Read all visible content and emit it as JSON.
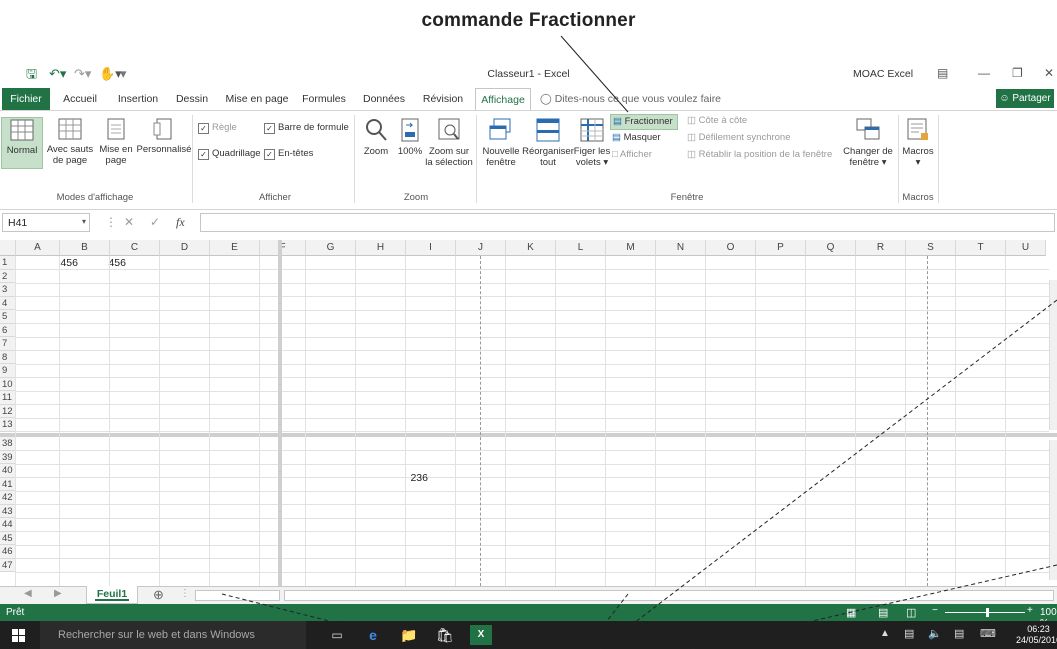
{
  "annotation": {
    "title": "commande Fractionner"
  },
  "window": {
    "title": "Classeur1 - Excel",
    "account": "MOAC Excel"
  },
  "tabs": [
    "Fichier",
    "Accueil",
    "Insertion",
    "Dessin",
    "Mise en page",
    "Formules",
    "Données",
    "Révision",
    "Affichage"
  ],
  "active_tab": "Affichage",
  "tell_me": "Dites-nous ce que vous voulez faire",
  "share": "Partager",
  "ribbon": {
    "modes": {
      "normal": "Normal",
      "saut_1": "Avec sauts",
      "saut_2": "de page",
      "mise_1": "Mise en",
      "mise_2": "page",
      "perso": "Personnalisé",
      "label": "Modes d'affichage"
    },
    "afficher": {
      "regle": "Règle",
      "quadrillage": "Quadrillage",
      "barre_formule": "Barre de formule",
      "entetes": "En-têtes",
      "label": "Afficher"
    },
    "zoom": {
      "zoom": "Zoom",
      "pct": "100%",
      "sel_1": "Zoom sur",
      "sel_2": "la sélection",
      "label": "Zoom"
    },
    "fenetre": {
      "nouvelle_1": "Nouvelle",
      "nouvelle_2": "fenêtre",
      "reorg_1": "Réorganiser",
      "reorg_2": "tout",
      "figer_1": "Figer les",
      "figer_2": "volets",
      "fractionner": "Fractionner",
      "masquer": "Masquer",
      "afficher": "Afficher",
      "cote": "Côte à côte",
      "defilement": "Défilement synchrone",
      "retablir": "Rétablir la position de la fenêtre",
      "changer_1": "Changer de",
      "changer_2": "fenêtre",
      "label": "Fenêtre"
    },
    "macros": {
      "macros": "Macros",
      "label": "Macros"
    }
  },
  "formula_bar": {
    "name_box": "H41",
    "fx": "fx",
    "value": ""
  },
  "columns": [
    "A",
    "B",
    "C",
    "D",
    "E",
    "F",
    "G",
    "H",
    "I",
    "J",
    "K",
    "L",
    "M",
    "N",
    "O",
    "P",
    "Q",
    "R",
    "S",
    "T",
    "U"
  ],
  "top_rows": [
    "1",
    "2",
    "3",
    "4",
    "5",
    "6",
    "7",
    "8",
    "9",
    "10",
    "11",
    "12",
    "13"
  ],
  "bottom_rows": [
    "38",
    "39",
    "40",
    "41",
    "42",
    "43",
    "44",
    "45",
    "46",
    "47"
  ],
  "cells": {
    "A1": "456",
    "B1": "456",
    "H40": "236"
  },
  "sheet_tab": "Feuil1",
  "status": {
    "ready": "Prêt",
    "zoom": "100 %"
  },
  "taskbar": {
    "search": "Rechercher sur le web et dans Windows",
    "time": "06:23",
    "date": "24/05/2016"
  }
}
